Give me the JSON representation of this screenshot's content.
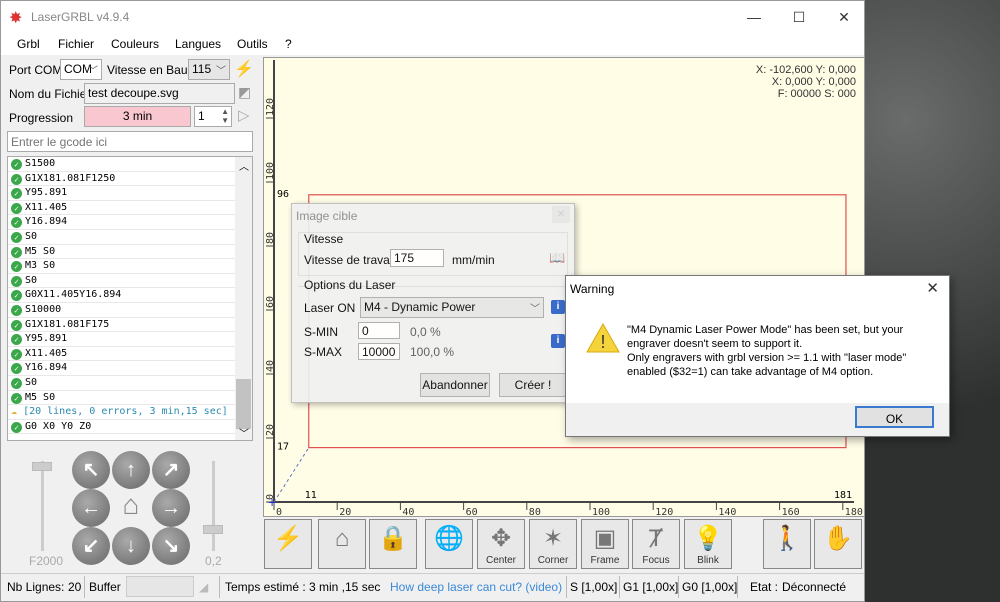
{
  "window": {
    "title": "LaserGRBL v4.9.4",
    "minimize": "—",
    "maximize": "☐",
    "close": "✕"
  },
  "menu": [
    "Grbl",
    "Fichier",
    "Couleurs",
    "Langues",
    "Outils",
    "?"
  ],
  "conn": {
    "port_label": "Port COM",
    "port_value": "COM",
    "baud_label": "Vitesse en Baud",
    "baud_value": "115"
  },
  "file": {
    "label": "Nom du Fichier",
    "value": "test decoupe.svg"
  },
  "progress": {
    "label": "Progression",
    "value": "3 min",
    "copies": "1"
  },
  "gcode_input": {
    "placeholder": "Entrer le gcode ici"
  },
  "gcode_lines": [
    "S1500",
    "G1X181.081F1250",
    "Y95.891",
    "X11.405",
    "Y16.894",
    "S0",
    "M5 S0",
    "M3 S0",
    "S0",
    "G0X11.405Y16.894",
    "S10000",
    "G1X181.081F175",
    "Y95.891",
    "X11.405",
    "Y16.894",
    "S0",
    "M5 S0"
  ],
  "gcode_summary": "[20 lines, 0 errors, 3 min,15 sec]",
  "gcode_last": "G0 X0 Y0 Z0",
  "sliders": {
    "speed_label": "F2000",
    "step_label": "0,2"
  },
  "canvas": {
    "coords": [
      "X: -102,600 Y: 0,000",
      "X: 0,000 Y: 0,000",
      "F: 00000 S: 000"
    ],
    "x_ticks": [
      "0",
      "20",
      "40",
      "60",
      "80",
      "100",
      "120",
      "140",
      "160",
      "180"
    ],
    "y_ticks": [
      "0",
      "20",
      "40",
      "60",
      "80",
      "100",
      "120"
    ],
    "x_marks": [
      "11",
      "181"
    ],
    "y_marks": [
      "17",
      "96"
    ],
    "shape_color": "#e05050"
  },
  "toolbar": [
    "",
    "",
    "",
    "",
    "Center",
    "Corner",
    "Frame",
    "Focus",
    "Blink",
    "",
    ""
  ],
  "status": {
    "lines_label": "Nb Lignes:",
    "lines_value": "20",
    "buffer_label": "Buffer",
    "time_label": "Temps estimé :",
    "time_value": "3 min ,15 sec",
    "link": "How deep laser can cut? (video)",
    "s": "S [1,00x]",
    "g1": "G1 [1,00x]",
    "g0": "G0 [1,00x]",
    "state_label": "Etat :",
    "state_value": "Déconnecté"
  },
  "dialog": {
    "title": "Image cible",
    "close": "✕",
    "speed_group": "Vitesse",
    "speed_label": "Vitesse de travail",
    "speed_value": "175",
    "speed_unit": "mm/min",
    "laser_group": "Options du Laser",
    "laser_on_label": "Laser ON",
    "laser_on_value": "M4 - Dynamic Power",
    "smin_label": "S-MIN",
    "smin_value": "0",
    "smin_pct": "0,0 %",
    "smax_label": "S-MAX",
    "smax_value": "10000",
    "smax_pct": "100,0 %",
    "cancel": "Abandonner",
    "create": "Créer !"
  },
  "warning": {
    "title": "Warning",
    "close": "✕",
    "lines": [
      "\"M4 Dynamic Laser Power Mode\" has been set, but your",
      "engraver doesn't seem to support it.",
      "Only engravers with grbl version >= 1.1 with \"laser mode\"",
      "enabled ($32=1) can take advantage of M4 option."
    ],
    "ok": "OK"
  }
}
